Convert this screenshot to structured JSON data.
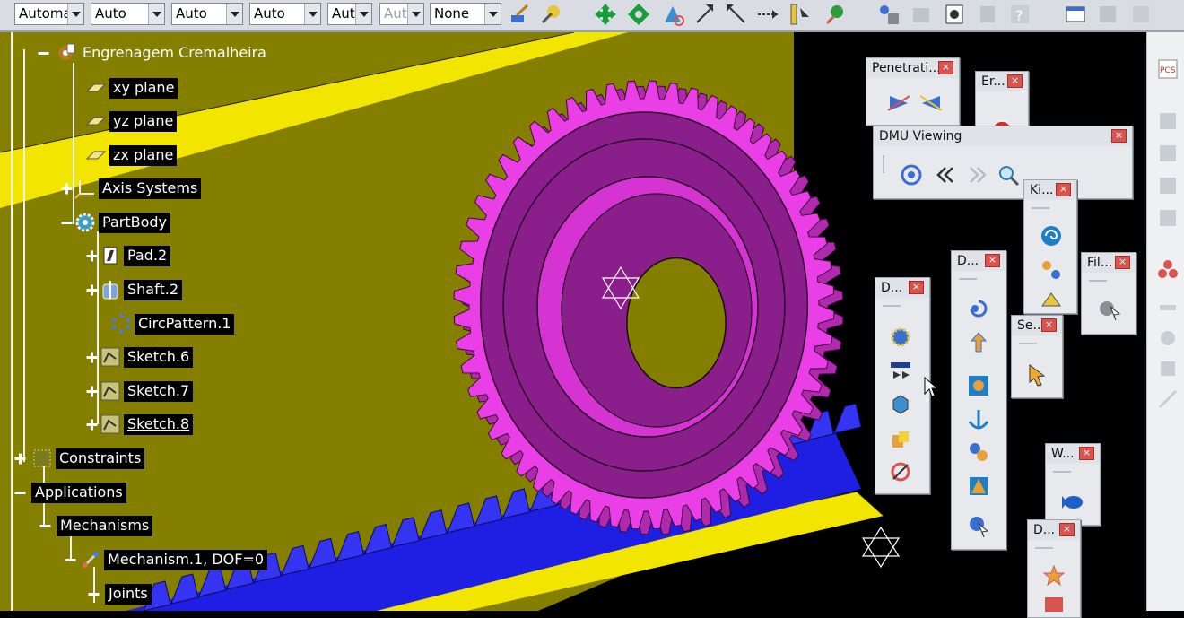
{
  "toolbar": {
    "combos": [
      {
        "value": "Automatic",
        "disabled": false
      },
      {
        "value": "Auto",
        "disabled": false
      },
      {
        "value": "Auto",
        "disabled": false
      },
      {
        "value": "Auto",
        "disabled": false
      },
      {
        "value": "Auto",
        "disabled": false
      },
      {
        "value": "Auto",
        "disabled": true
      },
      {
        "value": "None",
        "disabled": false
      }
    ]
  },
  "tree": {
    "root": "Engrenagem Cremalheira",
    "xy_plane": "xy plane",
    "yz_plane": "yz plane",
    "zx_plane": "zx plane",
    "axis_systems": "Axis Systems",
    "partbody": "PartBody",
    "pad": "Pad.2",
    "shaft": "Shaft.2",
    "circpattern": "CircPattern.1",
    "sketch6": "Sketch.6",
    "sketch7": "Sketch.7",
    "sketch8": "Sketch.8",
    "constraints": "Constraints",
    "applications": "Applications",
    "mechanisms": "Mechanisms",
    "mechanism1": "Mechanism.1, DOF=0",
    "joints": "Joints"
  },
  "floating": {
    "penetration": "Penetrati...",
    "er": "Er...",
    "dmu_viewing": "DMU Viewing",
    "ki": "Ki...",
    "fil": "Fil...",
    "d1": "D...",
    "d2": "D...",
    "se": "Se...",
    "w": "W...",
    "d3": "D...",
    "close": "×"
  },
  "colors": {
    "background": "#000000",
    "ground_plane": "#857f00",
    "rail_yellow": "#f2e600",
    "gear_face": "#8a1e8a",
    "gear_teeth": "#ea3ee6",
    "rack": "#1f1fe3",
    "toolbar_bg": "#d9dde3"
  }
}
